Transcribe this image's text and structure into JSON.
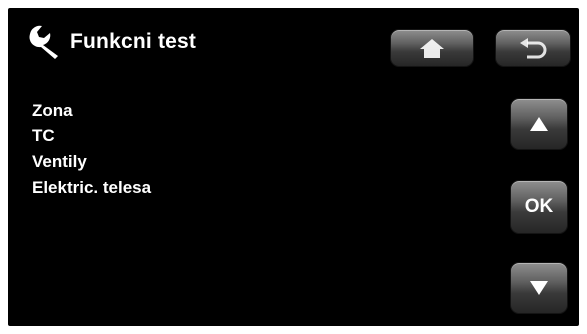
{
  "header": {
    "title": "Funkcni test",
    "icon": "wrench-icon"
  },
  "nav": {
    "home_icon": "home-icon",
    "back_icon": "back-arrow-icon"
  },
  "menu": {
    "items": [
      {
        "label": "Zona"
      },
      {
        "label": "TC"
      },
      {
        "label": "Ventily"
      },
      {
        "label": "Elektric. telesa"
      }
    ]
  },
  "controls": {
    "up_icon": "triangle-up-icon",
    "ok_label": "OK",
    "down_icon": "triangle-down-icon"
  },
  "colors": {
    "background": "#000000",
    "text": "#ffffff",
    "button_top": "#8f8f8f",
    "button_bottom": "#262626"
  }
}
